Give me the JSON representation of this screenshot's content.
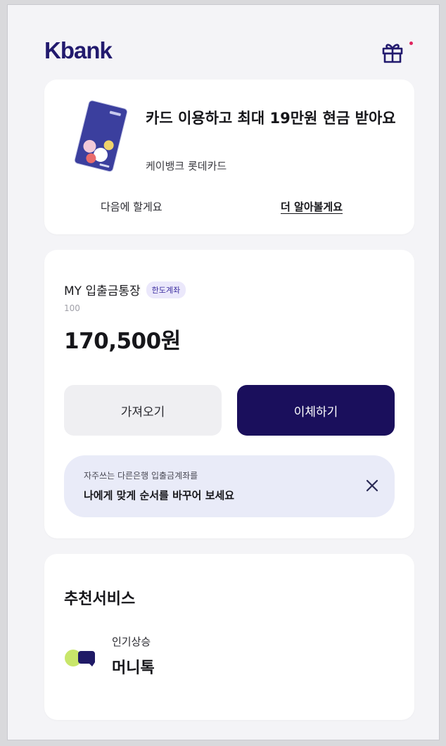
{
  "header": {
    "logo": "Kbank",
    "gift_icon": "gift-icon",
    "notification_color": "#e0245e"
  },
  "promo": {
    "title": "카드 이용하고 최대 19만원 현금 받아요",
    "subtitle": "케이뱅크 롯데카드",
    "later_label": "다음에 할게요",
    "more_label": "더 알아볼게요"
  },
  "account": {
    "name": "MY 입출금통장",
    "badge": "한도계좌",
    "number": "100",
    "balance": "170,500원",
    "bring_label": "가져오기",
    "transfer_label": "이체하기",
    "tip": {
      "line1": "자주쓰는 다른은행 입출금계좌를",
      "line2": "나에게 맞게 순서를 바꾸어 보세요"
    }
  },
  "recommend": {
    "title": "추천서비스",
    "items": [
      {
        "tag": "인기상승",
        "name": "머니톡",
        "icon": "chat-bubbles-icon"
      }
    ]
  },
  "colors": {
    "brand": "#221a6e",
    "primary_button": "#1a0f5c",
    "tip_background": "#e9ebf8"
  }
}
